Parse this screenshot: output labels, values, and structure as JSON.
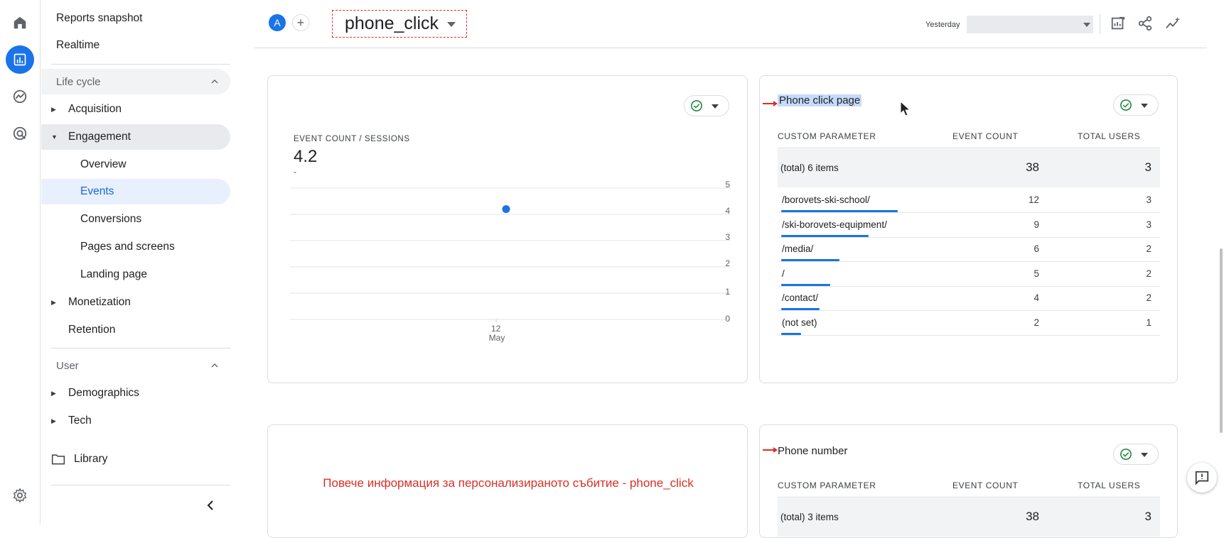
{
  "colors": {
    "accent": "#1a73e8",
    "annotation_red": "#d93025",
    "selected_bg": "#e8f0fe"
  },
  "rail": {
    "icons": [
      "home-icon",
      "reports-icon",
      "explore-icon",
      "advertising-icon",
      "settings-icon"
    ]
  },
  "sidebar": {
    "reports_snapshot": "Reports snapshot",
    "realtime": "Realtime",
    "life_cycle": "Life cycle",
    "acquisition": "Acquisition",
    "engagement": "Engagement",
    "overview": "Overview",
    "events": "Events",
    "conversions": "Conversions",
    "pages_and_screens": "Pages and screens",
    "landing_page": "Landing page",
    "monetization": "Monetization",
    "retention": "Retention",
    "user": "User",
    "demographics": "Demographics",
    "tech": "Tech",
    "library": "Library"
  },
  "topbar": {
    "avatar_letter": "A",
    "add_symbol": "+",
    "event_name": "phone_click",
    "date_label": "Yesterday",
    "date_value": ""
  },
  "chart_card": {
    "metric_label": "EVENT COUNT / SESSIONS",
    "metric_value": "4.2",
    "metric_delta": "-",
    "y_ticks": [
      "5",
      "4",
      "3",
      "2",
      "1",
      "0"
    ],
    "x_tick_day": "12",
    "x_tick_month": "May"
  },
  "chart_data": {
    "type": "scatter",
    "title": "",
    "xlabel": "",
    "ylabel": "",
    "x": [
      "12 May"
    ],
    "values": [
      4.2
    ],
    "ylim": [
      0,
      5
    ],
    "y_ticks": [
      0,
      1,
      2,
      3,
      4,
      5
    ],
    "grid": true
  },
  "phone_click_page": {
    "title": "Phone click page",
    "headers": [
      "CUSTOM PARAMETER",
      "EVENT COUNT",
      "TOTAL USERS"
    ],
    "total": {
      "label": "(total) 6 items",
      "event_count": "38",
      "total_users": "3"
    },
    "rows": [
      {
        "name": "/borovets-ski-school/",
        "event_count": "12",
        "total_users": "3",
        "share": 1.0
      },
      {
        "name": "/ski-borovets-equipment/",
        "event_count": "9",
        "total_users": "3",
        "share": 0.75
      },
      {
        "name": "/media/",
        "event_count": "6",
        "total_users": "2",
        "share": 0.5
      },
      {
        "name": "/",
        "event_count": "5",
        "total_users": "2",
        "share": 0.42
      },
      {
        "name": "/contact/",
        "event_count": "4",
        "total_users": "2",
        "share": 0.33
      },
      {
        "name": "(not set)",
        "event_count": "2",
        "total_users": "1",
        "share": 0.17
      }
    ]
  },
  "phone_number": {
    "title": "Phone number",
    "headers": [
      "CUSTOM PARAMETER",
      "EVENT COUNT",
      "TOTAL USERS"
    ],
    "total": {
      "label": "(total) 3 items",
      "event_count": "38",
      "total_users": "3"
    }
  },
  "annotation": {
    "text": "Повече информация за персонализираното събитие - phone_click"
  }
}
